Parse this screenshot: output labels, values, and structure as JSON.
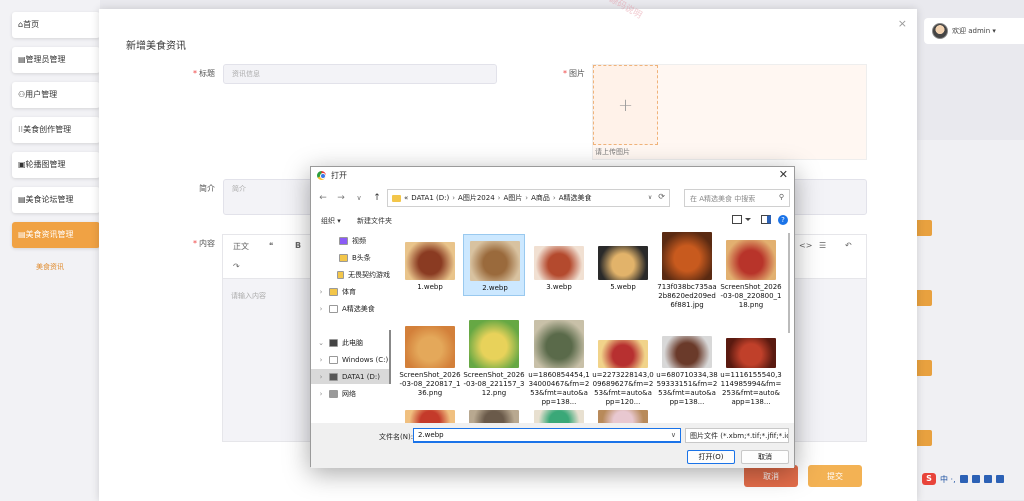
{
  "sidebar": {
    "items": [
      {
        "label": "⌂首页"
      },
      {
        "label": "▤管理员管理"
      },
      {
        "label": "⚇用户管理"
      },
      {
        "label": "⁝⁝美食创作管理"
      },
      {
        "label": "▣轮播图管理"
      },
      {
        "label": "▤美食论坛管理"
      },
      {
        "label": "▤美食资讯管理"
      }
    ],
    "sub_item": "美食资讯"
  },
  "header": {
    "user_label": "欢迎 admin ▾"
  },
  "form_dialog": {
    "title": "新增美食资讯",
    "close": "×",
    "title_label": "标题",
    "title_placeholder": "资讯信息",
    "image_label": "图片",
    "upload_hint": "请上传图片",
    "upload_plus": "+",
    "intro_label": "简介",
    "intro_placeholder": "简介",
    "content_label": "内容",
    "editor_paragraph": "正文",
    "editor_quote": "❝",
    "editor_bold": "B",
    "editor_redo": "↷",
    "editor_link": "<>",
    "editor_align": "☰",
    "editor_undo": "↶",
    "content_placeholder": "请输入内容",
    "cancel_label": "取消",
    "submit_label": "提交"
  },
  "watermarks": [
    "源码说明",
    "源码说明"
  ],
  "file_dialog": {
    "title": "打开",
    "close": "✕",
    "nav": {
      "back": "←",
      "forward": "→",
      "recent": "∨",
      "up": "↑"
    },
    "breadcrumb": [
      "«",
      "DATA1 (D:)",
      "A图片2024",
      "A图片",
      "A商品",
      "A精选美食"
    ],
    "refresh": "⟳",
    "search_placeholder": "在 A精选美食 中搜索",
    "search_icon": "⚲",
    "organize_label": "组织 ▾",
    "new_folder_label": "新建文件夹",
    "tree": [
      {
        "label": "视频",
        "color": "#8b5cf6"
      },
      {
        "label": "B头条",
        "color": "#f3c64a"
      },
      {
        "label": "无畏契约游戏",
        "color": "#f3c64a"
      },
      {
        "label": "体育",
        "color": "#f3c64a"
      },
      {
        "label": "A精选美食",
        "color": "#ffffff"
      },
      {
        "label": "此电脑",
        "color": "#444444"
      },
      {
        "label": "Windows (C:)",
        "color": "#ffffff"
      },
      {
        "label": "DATA1 (D:)",
        "color": "#555555"
      },
      {
        "label": "网络",
        "color": "#999999"
      }
    ],
    "files": [
      {
        "label": "1.webp",
        "colors": [
          "#8a3b22",
          "#e9c48b"
        ]
      },
      {
        "label": "2.webp",
        "colors": [
          "#9a6a3c",
          "#d8c2a0"
        ]
      },
      {
        "label": "3.webp",
        "colors": [
          "#b44a2e",
          "#f1e0d2"
        ]
      },
      {
        "label": "5.webp",
        "colors": [
          "#e2b36a",
          "#2a2a2a"
        ]
      },
      {
        "label": "713f038bc735aa2b8620ed209ed6f881.jpg",
        "colors": [
          "#c85a1e",
          "#5a2a12"
        ]
      },
      {
        "label": "ScreenShot_2026-03-08_220800_118.png",
        "colors": [
          "#b8342a",
          "#e2b070"
        ]
      },
      {
        "label": "ScreenShot_2026-03-08_220817_136.png",
        "colors": [
          "#e4a85a",
          "#d3803a"
        ]
      },
      {
        "label": "ScreenShot_2026-03-08_221157_312.png",
        "colors": [
          "#e8d25a",
          "#66a844"
        ]
      },
      {
        "label": "u=1860854454,134000467&fm=253&fmt=auto&app=138...",
        "colors": [
          "#5a6a4a",
          "#c8c0a8"
        ]
      },
      {
        "label": "u=2273228143,009689627&fm=253&fmt=auto&app=120...",
        "colors": [
          "#b73030",
          "#f1d38a"
        ]
      },
      {
        "label": "u=680710334,3859333151&fm=253&fmt=auto&app=138...",
        "colors": [
          "#6a3a2a",
          "#d8d8d8"
        ]
      },
      {
        "label": "u=1116155540,3114985994&fm=253&fmt=auto&app=138...",
        "colors": [
          "#c0402a",
          "#5a1a10"
        ]
      },
      {
        "label": "",
        "colors": [
          "#c43a2a",
          "#f0c080"
        ]
      },
      {
        "label": "",
        "colors": [
          "#6a5a4a",
          "#b8a890"
        ]
      },
      {
        "label": "",
        "colors": [
          "#3aa878",
          "#e8e0d0"
        ]
      },
      {
        "label": "",
        "colors": [
          "#e8c8d0",
          "#b88a5a"
        ]
      }
    ],
    "filename_label": "文件名(N):",
    "filename_value": "2.webp",
    "filetype_value": "图片文件 (*.xbm;*.tif;*.jfif;*.ico",
    "open_label": "打开(O)",
    "cancel_label": "取消"
  },
  "taskbar": {
    "logo": "S",
    "text": "中 ·,"
  },
  "colors": {
    "accent": "#f0a244",
    "link": "#1a73e8"
  }
}
